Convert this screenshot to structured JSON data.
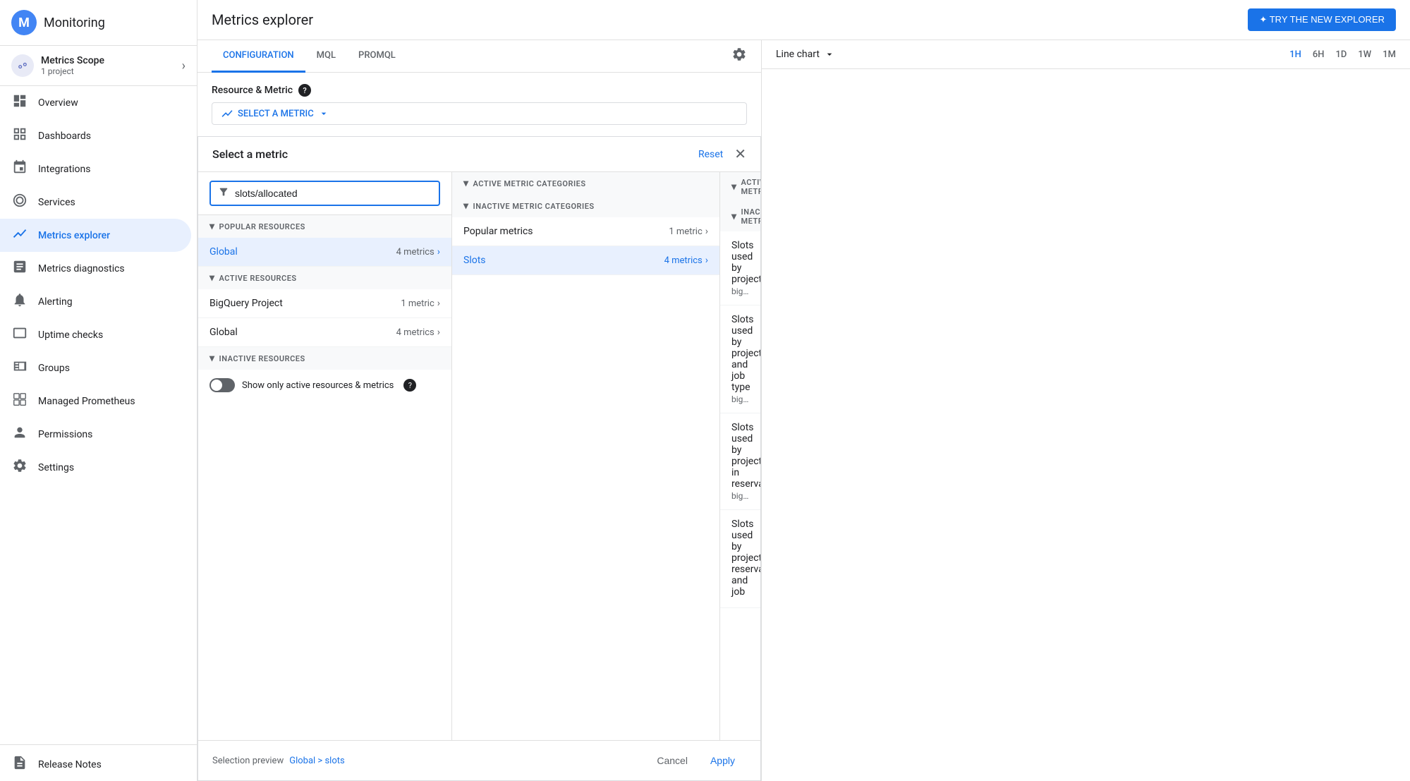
{
  "sidebar": {
    "app_name": "Monitoring",
    "metrics_scope": {
      "title": "Metrics Scope",
      "subtitle": "1 project"
    },
    "nav_items": [
      {
        "id": "overview",
        "label": "Overview",
        "icon": "📊"
      },
      {
        "id": "dashboards",
        "label": "Dashboards",
        "icon": "⊞"
      },
      {
        "id": "integrations",
        "label": "Integrations",
        "icon": "↗"
      },
      {
        "id": "services",
        "label": "Services",
        "icon": "◎"
      },
      {
        "id": "metrics-explorer",
        "label": "Metrics explorer",
        "icon": "📈",
        "active": true
      },
      {
        "id": "metrics-diagnostics",
        "label": "Metrics diagnostics",
        "icon": "📉"
      },
      {
        "id": "alerting",
        "label": "Alerting",
        "icon": "🔔"
      },
      {
        "id": "uptime-checks",
        "label": "Uptime checks",
        "icon": "🖥"
      },
      {
        "id": "groups",
        "label": "Groups",
        "icon": "▣"
      },
      {
        "id": "managed-prometheus",
        "label": "Managed Prometheus",
        "icon": "⊡"
      },
      {
        "id": "permissions",
        "label": "Permissions",
        "icon": "👤"
      },
      {
        "id": "settings",
        "label": "Settings",
        "icon": "⚙"
      }
    ],
    "bottom_items": [
      {
        "id": "release-notes",
        "label": "Release Notes",
        "icon": "📋"
      }
    ]
  },
  "header": {
    "title": "Metrics explorer",
    "try_new_btn": "✦ TRY THE NEW EXPLORER"
  },
  "tabs": {
    "items": [
      {
        "id": "configuration",
        "label": "CONFIGURATION",
        "active": true
      },
      {
        "id": "mql",
        "label": "MQL"
      },
      {
        "id": "promql",
        "label": "PROMQL"
      }
    ]
  },
  "resource_metric": {
    "label": "Resource & Metric"
  },
  "select_metric_btn": "SELECT A METRIC",
  "metric_selector": {
    "title": "Select a metric",
    "reset_label": "Reset",
    "close_label": "✕",
    "search_placeholder": "slots/allocated",
    "search_value": "slots/allocated",
    "resources": {
      "popular_section": "POPULAR RESOURCES",
      "active_section": "ACTIVE RESOURCES",
      "inactive_section": "INACTIVE RESOURCES",
      "popular_items": [
        {
          "name": "Global",
          "count": "4 metrics",
          "blue": true
        }
      ],
      "active_items": [
        {
          "name": "BigQuery Project",
          "count": "1 metric"
        },
        {
          "name": "Global",
          "count": "4 metrics"
        }
      ],
      "toggle_label": "Show only active resources & metrics"
    },
    "categories": {
      "active_section": "ACTIVE METRIC CATEGORIES",
      "inactive_section": "INACTIVE METRIC CATEGORIES",
      "popular_item": {
        "name": "Popular metrics",
        "count": "1 metric"
      },
      "items": [
        {
          "name": "Slots",
          "count": "4 metrics",
          "blue": true,
          "selected": true
        }
      ]
    },
    "metrics": {
      "active_section": "ACTIVE METRICS",
      "inactive_section": "INACTIVE METRICS",
      "items": [
        {
          "name": "Slots used by project",
          "path": "bigquery.googleapis.com/slots/allocated_for_p..."
        },
        {
          "name": "Slots used by project and job type",
          "path": "bigquery.googleapis.com/slots/allocated_for_p..."
        },
        {
          "name": "Slots used by project in reservation",
          "path": "bigquery.googleapis.com/slots/allocated_for_r..."
        },
        {
          "name": "Slots used by project, reservation, and job",
          "path": ""
        }
      ]
    },
    "preview": {
      "label": "Selection preview",
      "value": "Global > slots"
    },
    "cancel_btn": "Cancel",
    "apply_btn": "Apply"
  },
  "chart": {
    "chart_type": "Line chart",
    "time_options": [
      {
        "label": "1H",
        "active": true
      },
      {
        "label": "6H"
      },
      {
        "label": "1D"
      },
      {
        "label": "1W"
      },
      {
        "label": "1M"
      }
    ]
  }
}
